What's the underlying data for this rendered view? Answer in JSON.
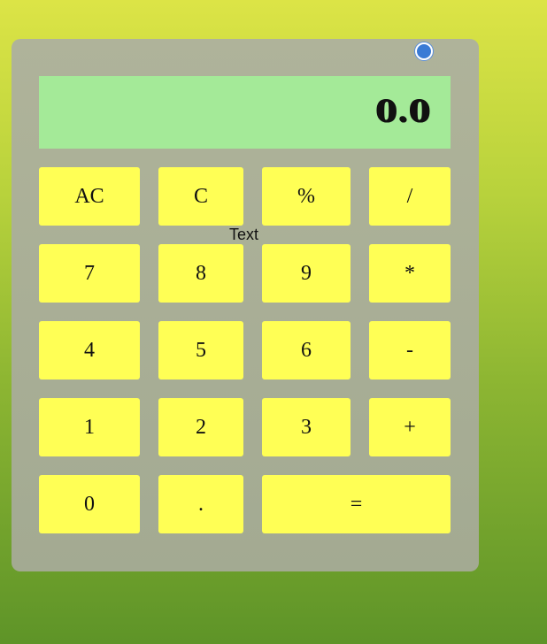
{
  "display": {
    "value": "0.0"
  },
  "floating_label": "Text",
  "keys": {
    "ac": "AC",
    "c": "C",
    "percent": "%",
    "divide": "/",
    "seven": "7",
    "eight": "8",
    "nine": "9",
    "multiply": "*",
    "four": "4",
    "five": "5",
    "six": "6",
    "minus": "-",
    "one": "1",
    "two": "2",
    "three": "3",
    "plus": "+",
    "zero": "0",
    "dot": ".",
    "equals": "="
  },
  "colors": {
    "background_top": "#dce446",
    "background_bottom": "#5e9428",
    "calculator_body": "#a9ae95",
    "display_bg": "#a4ea98",
    "key_bg": "#ffff55",
    "radio_accent": "#3a7bd5"
  }
}
